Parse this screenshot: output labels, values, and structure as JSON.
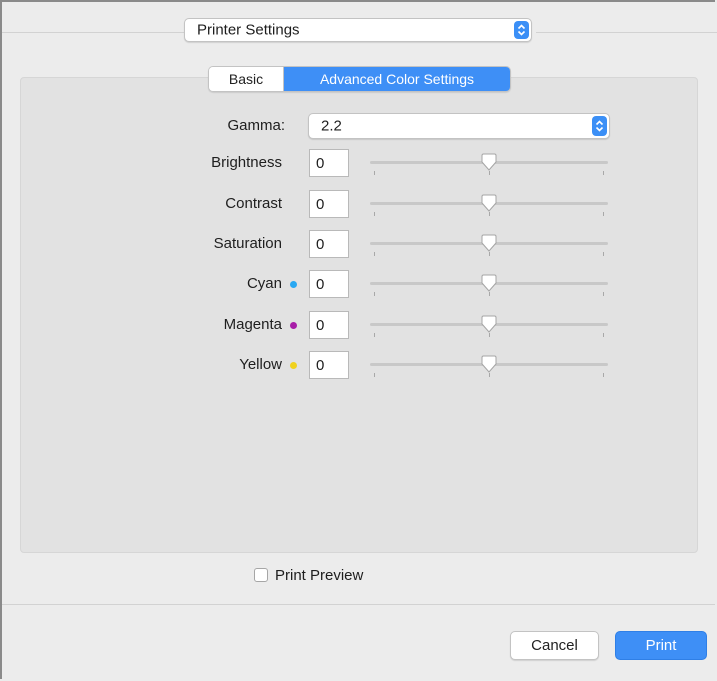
{
  "header": {
    "preset_popup": "Printer Settings"
  },
  "tabs": [
    {
      "label": "Basic",
      "selected": false
    },
    {
      "label": "Advanced Color Settings",
      "selected": true
    }
  ],
  "gamma": {
    "label": "Gamma:",
    "value": "2.2"
  },
  "sliders": [
    {
      "label": "Brightness",
      "value": "0",
      "dot_color": null,
      "level": 0.5
    },
    {
      "label": "Contrast",
      "value": "0",
      "dot_color": null,
      "level": 0.5
    },
    {
      "label": "Saturation",
      "value": "0",
      "dot_color": null,
      "level": 0.5
    },
    {
      "label": "Cyan",
      "value": "0",
      "dot_color": "#29a8f2",
      "level": 0.5
    },
    {
      "label": "Magenta",
      "value": "0",
      "dot_color": "#a81ea8",
      "level": 0.5
    },
    {
      "label": "Yellow",
      "value": "0",
      "dot_color": "#f0d21e",
      "level": 0.5
    }
  ],
  "print_preview": {
    "label": "Print Preview",
    "checked": false
  },
  "buttons": {
    "cancel": "Cancel",
    "print": "Print"
  },
  "colors": {
    "accent": "#3e8ff6"
  }
}
